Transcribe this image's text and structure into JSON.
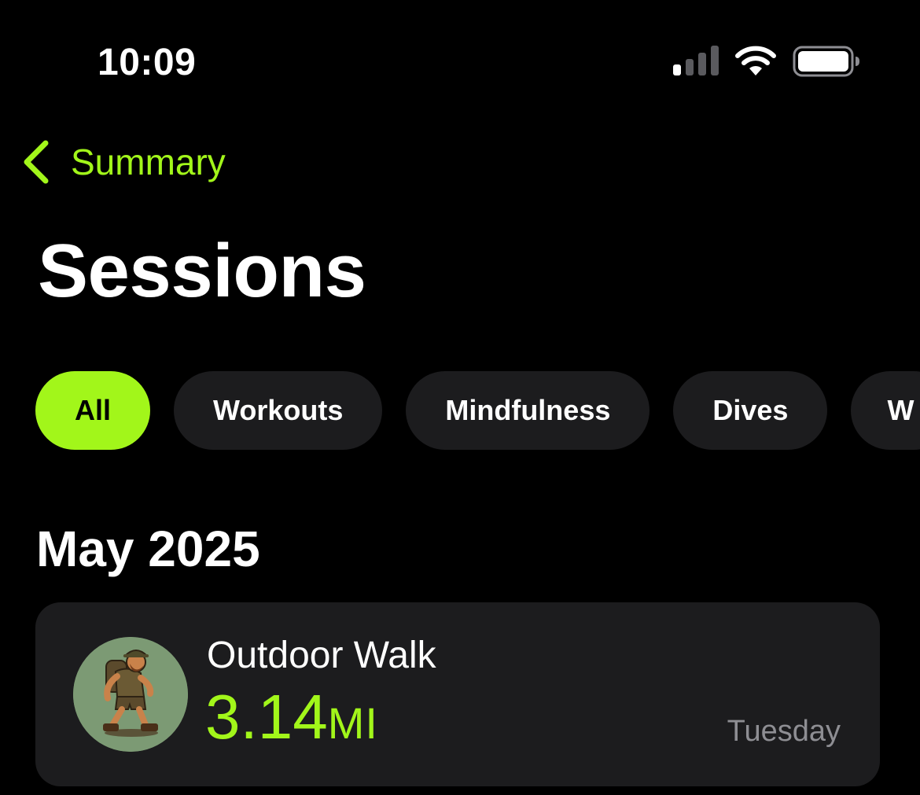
{
  "status_bar": {
    "time": "10:09",
    "icons": [
      "cellular-signal-icon",
      "wifi-icon",
      "battery-icon"
    ]
  },
  "nav": {
    "back_label": "Summary",
    "back_icon": "chevron-left-icon"
  },
  "page": {
    "title": "Sessions"
  },
  "filters": {
    "selected": "All",
    "items": [
      {
        "label": "All"
      },
      {
        "label": "Workouts"
      },
      {
        "label": "Mindfulness"
      },
      {
        "label": "Dives"
      },
      {
        "label": "W"
      }
    ]
  },
  "section": {
    "title": "May 2025"
  },
  "sessions": [
    {
      "name": "Outdoor Walk",
      "value": "3.14",
      "unit": "MI",
      "day": "Tuesday",
      "icon": "hiker-avatar-icon"
    }
  ],
  "colors": {
    "accent": "#a2f61a",
    "background": "#000000",
    "card": "#1c1c1e",
    "secondary_text": "#8e8e93"
  }
}
